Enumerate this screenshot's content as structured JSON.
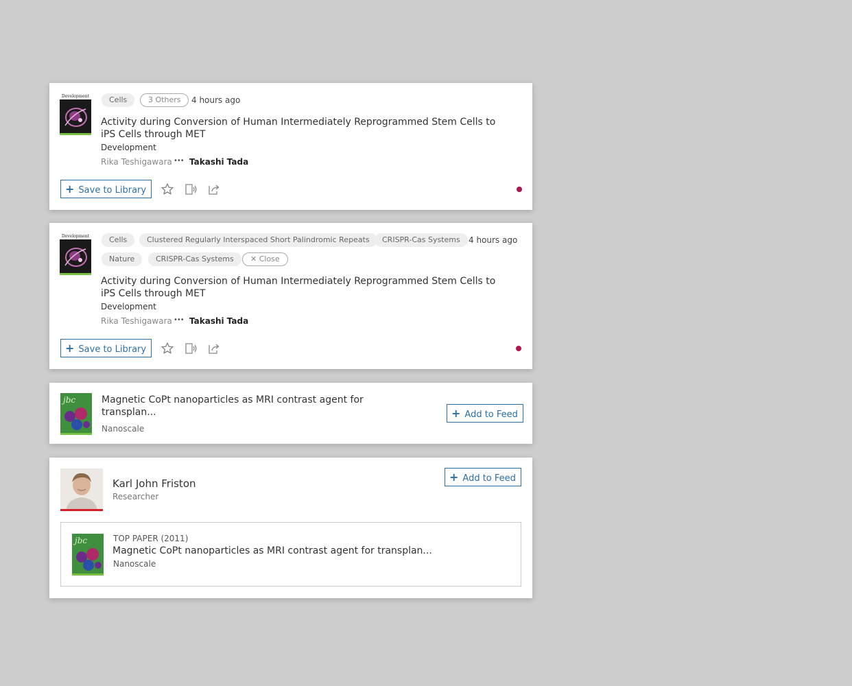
{
  "card1": {
    "tags": [
      "Cells",
      "3 Others"
    ],
    "time": "4 hours ago",
    "title": "Activity during Conversion of Human Intermediately Reprogrammed Stem Cells to iPS Cells through MET",
    "journal": "Development",
    "author_first": "Rika Teshigawara",
    "author_last": "Takashi Tada",
    "save_label": "Save to Library"
  },
  "card2": {
    "tags": [
      "Cells",
      "Clustered Regularly Interspaced Short Palindromic Repeats",
      "CRISPR-Cas Systems",
      "Nature",
      "CRISPR-Cas Systems",
      "✕ Close"
    ],
    "time": "4 hours ago",
    "title": "Activity during Conversion of Human Intermediately Reprogrammed Stem Cells to iPS Cells through MET",
    "journal": "Development",
    "author_first": "Rika Teshigawara",
    "author_last": "Takashi Tada",
    "save_label": "Save to Library"
  },
  "card3": {
    "title": "Magnetic CoPt nanoparticles as MRI contrast agent for transplan...",
    "journal": "Nanoscale",
    "add_label": "Add to Feed"
  },
  "card4": {
    "name": "Karl John Friston",
    "role": "Researcher",
    "add_label": "Add to Feed",
    "top_paper_label": "TOP PAPER (2011)",
    "paper_title": "Magnetic CoPt nanoparticles as MRI contrast agent for transplan...",
    "paper_journal": "Nanoscale"
  },
  "cover_dev_masthead": "Development",
  "cover_jbc_masthead": "jbc",
  "colors": {
    "accent_blue": "#2a6fa8",
    "unread_dot": "#b0174f",
    "cover_border": "#7ac143",
    "avatar_border": "#d31f25"
  },
  "icons": [
    "plus-icon",
    "star-icon",
    "listen-icon",
    "share-icon"
  ]
}
